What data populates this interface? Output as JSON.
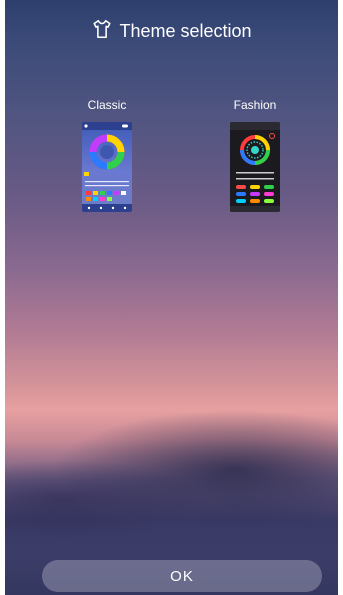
{
  "header": {
    "title": "Theme selection",
    "icon": "shirt-icon"
  },
  "themes": [
    {
      "label": "Classic"
    },
    {
      "label": "Fashion"
    }
  ],
  "footer": {
    "ok_label": "OK"
  }
}
